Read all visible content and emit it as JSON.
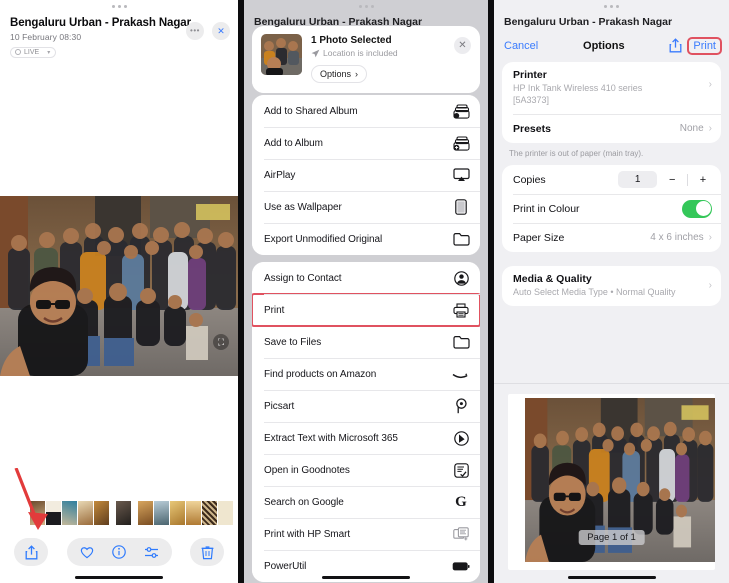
{
  "left_panel": {
    "name": "photos-detail-screen",
    "title": "Bengaluru Urban - Prakash Nagar",
    "datetime": "10 February  08:30",
    "live_badge": "LIVE",
    "more_button": "•••",
    "close_button": "✕",
    "toolbar": {
      "share": "share-icon",
      "favorite": "heart-icon",
      "info": "info-icon",
      "adjust": "adjust-icon",
      "delete": "trash-icon"
    },
    "live_photo_icon": "live-photo-icon"
  },
  "middle_panel": {
    "name": "share-sheet-screen",
    "background_title": "Bengaluru Urban - Prakash Nagar",
    "preview": {
      "title": "1 Photo Selected",
      "subtitle": "Location is included",
      "location_icon": "location-arrow-icon",
      "options_label": "Options",
      "options_chevron": "›",
      "close_button": "✕"
    },
    "group1": [
      {
        "label": "Add to Shared Album",
        "icon": "shared-album-icon"
      },
      {
        "label": "Add to Album",
        "icon": "add-album-icon"
      },
      {
        "label": "AirPlay",
        "icon": "airplay-icon"
      },
      {
        "label": "Use as Wallpaper",
        "icon": "wallpaper-icon"
      },
      {
        "label": "Export Unmodified Original",
        "icon": "folder-icon"
      }
    ],
    "group2": [
      {
        "label": "Assign to Contact",
        "icon": "contact-icon",
        "highlighted": false
      },
      {
        "label": "Print",
        "icon": "printer-icon",
        "highlighted": true
      },
      {
        "label": "Save to Files",
        "icon": "folder-icon",
        "highlighted": false
      },
      {
        "label": "Find products on Amazon",
        "icon": "amazon-icon",
        "highlighted": false
      },
      {
        "label": "Picsart",
        "icon": "picsart-icon",
        "highlighted": false
      },
      {
        "label": "Extract Text with Microsoft 365",
        "icon": "microsoft365-icon",
        "highlighted": false
      },
      {
        "label": "Open in Goodnotes",
        "icon": "goodnotes-icon",
        "highlighted": false
      },
      {
        "label": "Search on Google",
        "icon": "google-icon",
        "highlighted": false
      },
      {
        "label": "Print with HP Smart",
        "icon": "hp-smart-icon",
        "highlighted": false
      },
      {
        "label": "PowerUtil",
        "icon": "battery-icon",
        "highlighted": false
      }
    ],
    "highlight_color": "#e05260"
  },
  "right_panel": {
    "name": "printer-options-screen",
    "background_title": "Bengaluru Urban - Prakash Nagar",
    "nav": {
      "cancel": "Cancel",
      "title": "Options",
      "share_icon": "share-icon",
      "print": "Print"
    },
    "printer": {
      "label": "Printer",
      "value": "HP Ink Tank Wireless 410 series [5A3373]",
      "chevron": "›"
    },
    "presets": {
      "label": "Presets",
      "value": "None",
      "chevron": "›"
    },
    "status_note": "The printer is out of paper (main tray).",
    "copies": {
      "label": "Copies",
      "value": "1",
      "minus": "−",
      "plus": "+"
    },
    "print_in_colour": {
      "label": "Print in Colour",
      "state": "on",
      "on_color": "#34c759"
    },
    "paper_size": {
      "label": "Paper Size",
      "value": "4 x 6 inches",
      "chevron": "›"
    },
    "media_quality": {
      "label": "Media & Quality",
      "value": "Auto Select Media Type • Normal Quality",
      "chevron": "›"
    },
    "page_indicator": "Page 1 of 1",
    "accent_color": "#3a7bfd",
    "highlight_color": "#e05260"
  }
}
